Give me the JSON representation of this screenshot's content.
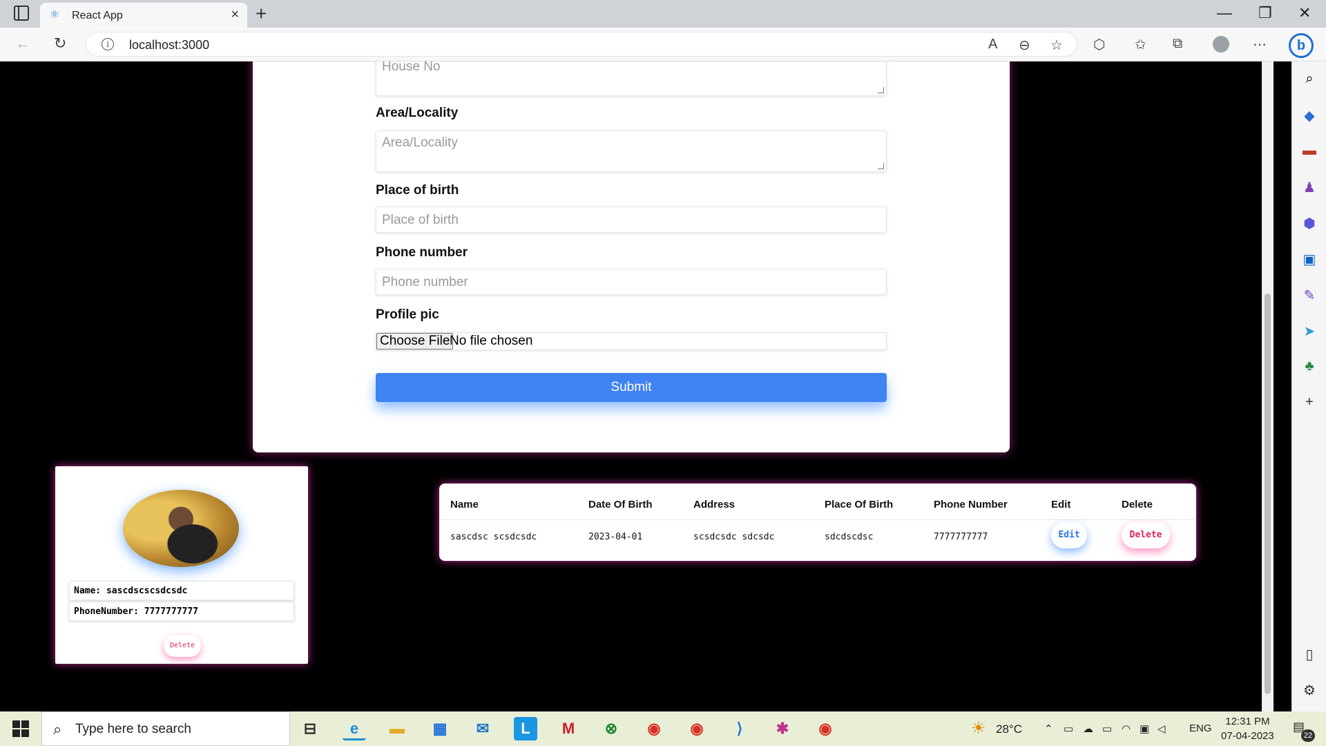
{
  "browser": {
    "tab_title": "React App",
    "url": "localhost:3000",
    "new_tab": "+",
    "close_tab": "×",
    "window_controls": {
      "minimize": "—",
      "restore": "❐",
      "close": "✕"
    }
  },
  "form": {
    "house_no_placeholder": "House No",
    "area_label": "Area/Locality",
    "area_placeholder": "Area/Locality",
    "birthplace_label": "Place of birth",
    "birthplace_placeholder": "Place of birth",
    "phone_label": "Phone number",
    "phone_placeholder": "Phone number",
    "pic_label": "Profile pic",
    "file_button": "Choose File",
    "file_status": "No file chosen",
    "submit_label": "Submit"
  },
  "profile_card": {
    "name_line": "Name: sascdscscsdcsdc",
    "phone_line": "PhoneNumber: 7777777777",
    "delete_label": "Delete"
  },
  "table": {
    "headers": [
      "Name",
      "Date Of Birth",
      "Address",
      "Place Of Birth",
      "Phone Number",
      "Edit",
      "Delete"
    ],
    "rows": [
      {
        "name": "sascdsc scsdcsdc",
        "dob": "2023-04-01",
        "address": "scsdcsdc sdcsdc",
        "place_of_birth": "sdcdscdsc",
        "phone": "7777777777",
        "edit_label": "Edit",
        "delete_label": "Delete"
      }
    ]
  },
  "taskbar": {
    "search_placeholder": "Type here to search",
    "weather": "28°C",
    "language": "ENG",
    "time": "12:31 PM",
    "date": "07-04-2023",
    "notifications": "22"
  },
  "colors": {
    "accent": "#3f83f2",
    "danger": "#e0245e",
    "glow": "#ff3cc8"
  }
}
